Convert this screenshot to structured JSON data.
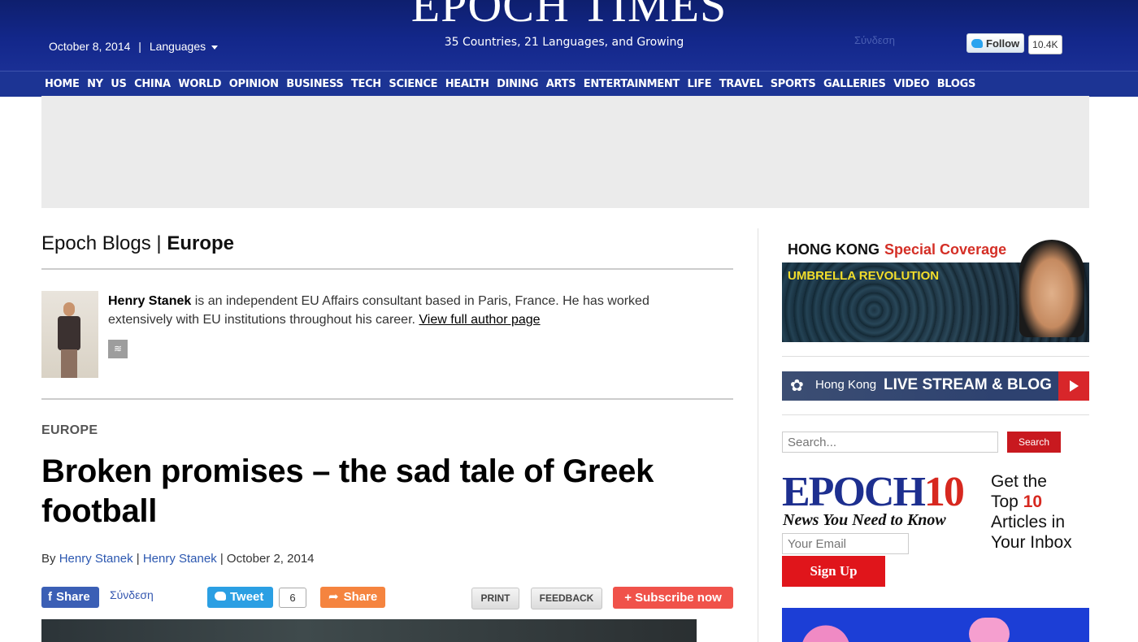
{
  "header": {
    "logo": "EPOCH TIMES",
    "tagline": "35 Countries, 21 Languages, and Growing",
    "date": "October 8, 2014",
    "languages_label": "Languages",
    "signin": "Σύνδεση",
    "twitter_follow": "Follow",
    "twitter_count": "10.4K"
  },
  "nav": {
    "items": [
      "HOME",
      "NY",
      "US",
      "CHINA",
      "WORLD",
      "OPINION",
      "BUSINESS",
      "TECH",
      "SCIENCE",
      "HEALTH",
      "DINING",
      "ARTS",
      "ENTERTAINMENT",
      "LIFE",
      "TRAVEL",
      "SPORTS",
      "GALLERIES",
      "VIDEO",
      "BLOGS"
    ]
  },
  "main": {
    "section_prefix": "Epoch Blogs | ",
    "section_name": "Europe",
    "author": {
      "name": "Henry Stanek",
      "bio": " is an independent EU Affairs consultant based in Paris, France. He has worked extensively with EU institutions throughout his career. ",
      "link": "View full author page"
    },
    "category": "EUROPE",
    "headline": "Broken promises – the sad tale of Greek football",
    "byline": {
      "by": "By ",
      "author1": "Henry Stanek",
      "sep1": " | ",
      "author2": "Henry Stanek",
      "date": " | October 2, 2014"
    },
    "share": {
      "fb_label": "Share",
      "fb_signin": "Σύνδεση",
      "tweet_label": "Tweet",
      "tweet_count": "6",
      "share_label": "Share",
      "print_label": "PRINT",
      "feedback_label": "FEEDBACK",
      "subscribe_label": "+ Subscribe now"
    }
  },
  "sidebar": {
    "hk": {
      "title": "HONG KONG",
      "subtitle": "Special Coverage",
      "umbrella": "UMBRELLA REVOLUTION"
    },
    "live": {
      "prefix": "Hong Kong",
      "title": "LIVE STREAM & BLOG"
    },
    "search": {
      "placeholder": "Search...",
      "button": "Search"
    },
    "epoch10": {
      "brand": "EPOCH",
      "number": "10",
      "tagline": "News You Need to Know",
      "side_line1": "Get the",
      "side_top": "Top ",
      "side_ten": "10",
      "side_line3": "Articles in",
      "side_line4": "Your Inbox",
      "email_placeholder": "Your Email",
      "signup": "Sign Up"
    }
  },
  "colors": {
    "header_bg": "#13278a",
    "nav_bg": "#1c3494",
    "accent_red": "#d7281f",
    "link_blue": "#2b57b0"
  }
}
